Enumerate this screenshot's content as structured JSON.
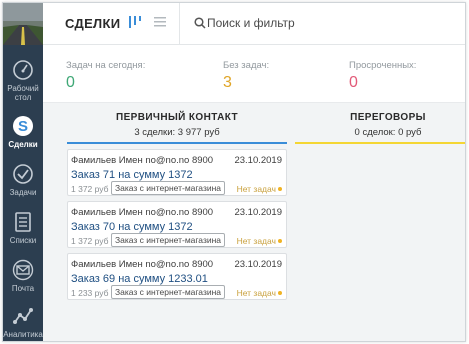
{
  "colors": {
    "sidebar_bg": "#2c3e50",
    "accent_blue": "#3a8dd8",
    "green": "#3fa876",
    "amber": "#e0a526",
    "red": "#e25a78",
    "link_blue": "#1f4f82",
    "negotiation_line": "#f4d633"
  },
  "sidebar": {
    "items": [
      {
        "label": "Рабочий стол",
        "line1": "Рабочий",
        "line2": "стол",
        "icon": "dashboard-gauge-icon"
      },
      {
        "label": "Сделки",
        "icon": "deals-dollar-icon",
        "active": true
      },
      {
        "label": "Задачи",
        "icon": "tasks-check-icon"
      },
      {
        "label": "Списки",
        "icon": "lists-icon"
      },
      {
        "label": "Почта",
        "icon": "mail-icon"
      },
      {
        "label": "Аналитика",
        "icon": "analytics-icon"
      }
    ]
  },
  "header": {
    "title": "СДЕЛКИ",
    "search_placeholder": "Поиск и фильтр"
  },
  "stats": [
    {
      "label": "Задач на сегодня:",
      "value": "0",
      "color": "#3fa876"
    },
    {
      "label": "Без задач:",
      "value": "3",
      "color": "#e0a526"
    },
    {
      "label": "Просроченных:",
      "value": "0",
      "color": "#e25a78"
    }
  ],
  "columns": [
    {
      "name": "ПЕРВИЧНЫЙ КОНТАКТ",
      "summary": "3 сделки: 3 977 руб"
    },
    {
      "name": "ПЕРЕГОВОРЫ",
      "summary": "0 сделок: 0 руб"
    }
  ],
  "cards": [
    {
      "contact": "Фамильев Имен no@no.no 8900",
      "date": "23.10.2019",
      "title": "Заказ 71 на сумму 1372",
      "price": "1 372 руб",
      "tag": "Заказ с интернет-магазина",
      "status": "Нет задач"
    },
    {
      "contact": "Фамильев Имен no@no.no 8900",
      "date": "23.10.2019",
      "title": "Заказ 70 на сумму 1372",
      "price": "1 372 руб",
      "tag": "Заказ с интернет-магазина",
      "status": "Нет задач"
    },
    {
      "contact": "Фамильев Имен no@no.no 8900",
      "date": "23.10.2019",
      "title": "Заказ 69 на сумму 1233.01",
      "price": "1 233 руб",
      "tag": "Заказ с интернет-магазина",
      "status": "Нет задач"
    }
  ]
}
